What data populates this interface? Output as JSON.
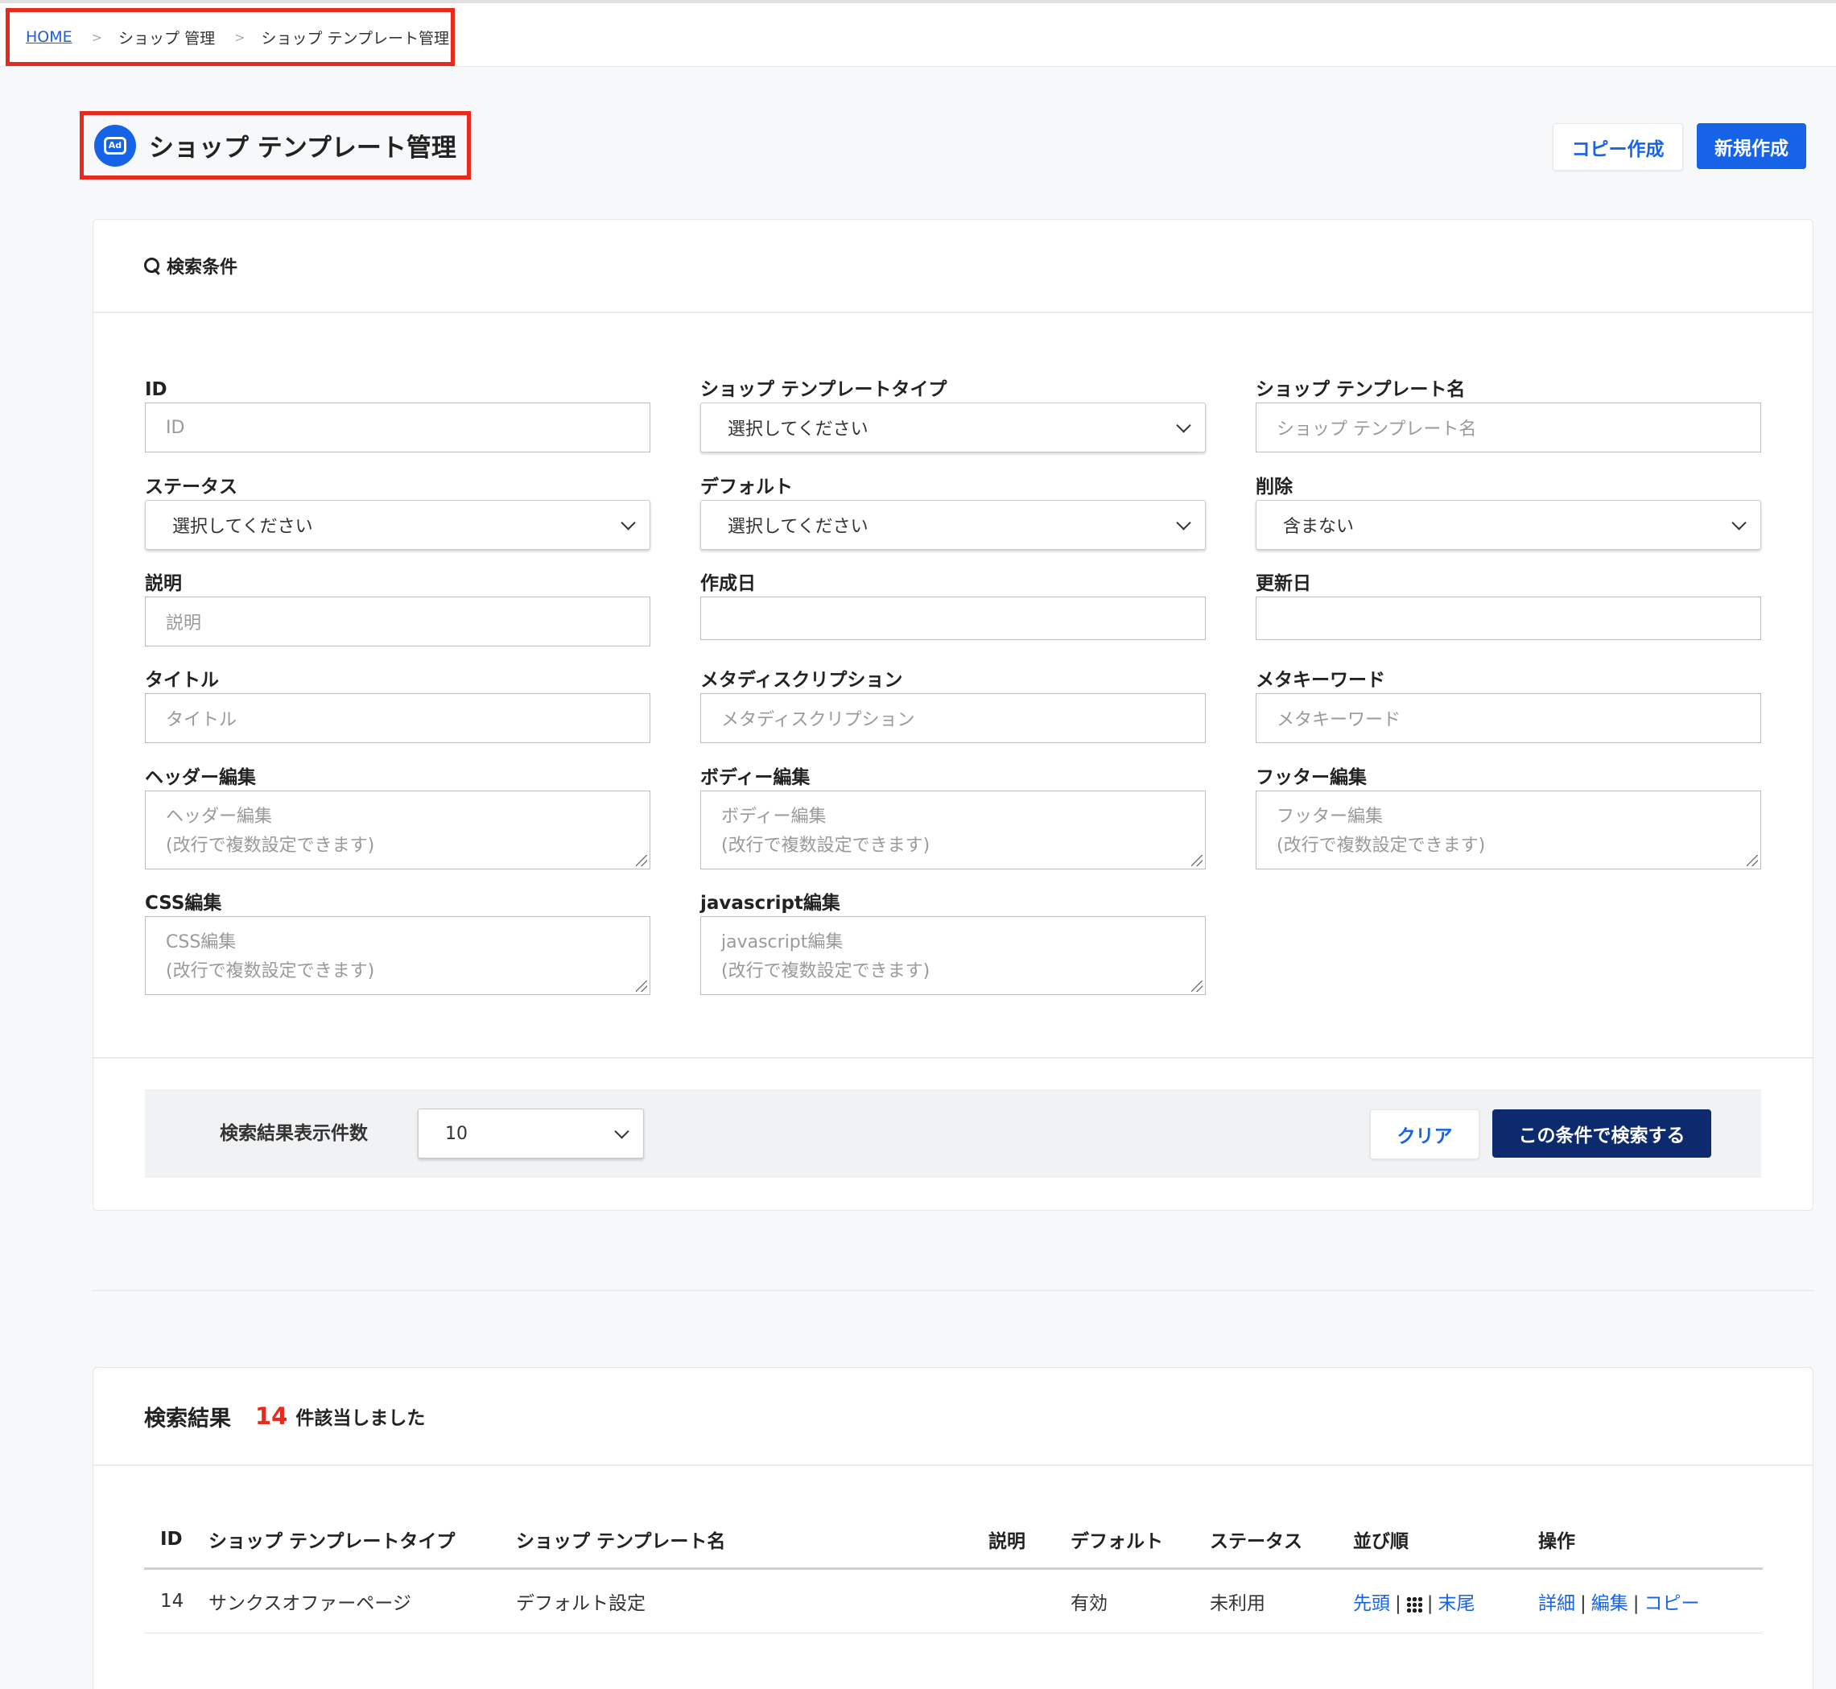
{
  "breadcrumb": {
    "home": "HOME",
    "sep1": ">",
    "item1": "ショップ 管理",
    "sep2": ">",
    "item2": "ショップ テンプレート管理"
  },
  "header": {
    "icon_text": "Ad",
    "title": "ショップ テンプレート管理",
    "copy_button": "コピー作成",
    "new_button": "新規作成"
  },
  "search": {
    "heading": "検索条件",
    "fields": {
      "id": {
        "label": "ID",
        "placeholder": "ID"
      },
      "template_type": {
        "label": "ショップ テンプレートタイプ",
        "value": "選択してください"
      },
      "template_name": {
        "label": "ショップ テンプレート名",
        "placeholder": "ショップ テンプレート名"
      },
      "status": {
        "label": "ステータス",
        "value": "選択してください"
      },
      "default": {
        "label": "デフォルト",
        "value": "選択してください"
      },
      "deleted": {
        "label": "削除",
        "value": "含まない"
      },
      "description": {
        "label": "説明",
        "placeholder": "説明"
      },
      "created": {
        "label": "作成日",
        "placeholder": ""
      },
      "updated": {
        "label": "更新日",
        "placeholder": ""
      },
      "title": {
        "label": "タイトル",
        "placeholder": "タイトル"
      },
      "meta_description": {
        "label": "メタディスクリプション",
        "placeholder": "メタディスクリプション"
      },
      "meta_keywords": {
        "label": "メタキーワード",
        "placeholder": "メタキーワード"
      },
      "header_edit": {
        "label": "ヘッダー編集",
        "placeholder_line1": "ヘッダー編集",
        "placeholder_line2": "(改行で複数設定できます)"
      },
      "body_edit": {
        "label": "ボディー編集",
        "placeholder_line1": "ボディー編集",
        "placeholder_line2": "(改行で複数設定できます)"
      },
      "footer_edit": {
        "label": "フッター編集",
        "placeholder_line1": "フッター編集",
        "placeholder_line2": "(改行で複数設定できます)"
      },
      "css_edit": {
        "label": "CSS編集",
        "placeholder_line1": "CSS編集",
        "placeholder_line2": "(改行で複数設定できます)"
      },
      "js_edit": {
        "label": "javascript編集",
        "placeholder_line1": "javascript編集",
        "placeholder_line2": "(改行で複数設定できます)"
      }
    },
    "per_page_label": "検索結果表示件数",
    "per_page_value": "10",
    "clear_button": "クリア",
    "search_button": "この条件で検索する"
  },
  "results": {
    "heading": "検索結果",
    "count": "14",
    "count_suffix": "件該当しました",
    "columns": [
      "ID",
      "ショップ テンプレートタイプ",
      "ショップ テンプレート名",
      "説明",
      "デフォルト",
      "ステータス",
      "並び順",
      "操作"
    ],
    "rows": [
      {
        "id": "14",
        "type": "サンクスオファーページ",
        "name": "デフォルト設定",
        "description": "",
        "default": "有効",
        "status": "未利用",
        "order_first": "先頭",
        "order_last": "末尾",
        "action_detail": "詳細",
        "action_edit": "編集",
        "action_copy": "コピー"
      }
    ],
    "separator": "|"
  },
  "colors": {
    "accent": "#1763e8",
    "highlight_border": "#e8291c",
    "search_button": "#0d2a6e",
    "count": "#e8291c"
  },
  "icons": {
    "title": "ad-badge-icon",
    "search": "search-icon",
    "sort": "grid-dots-icon"
  }
}
